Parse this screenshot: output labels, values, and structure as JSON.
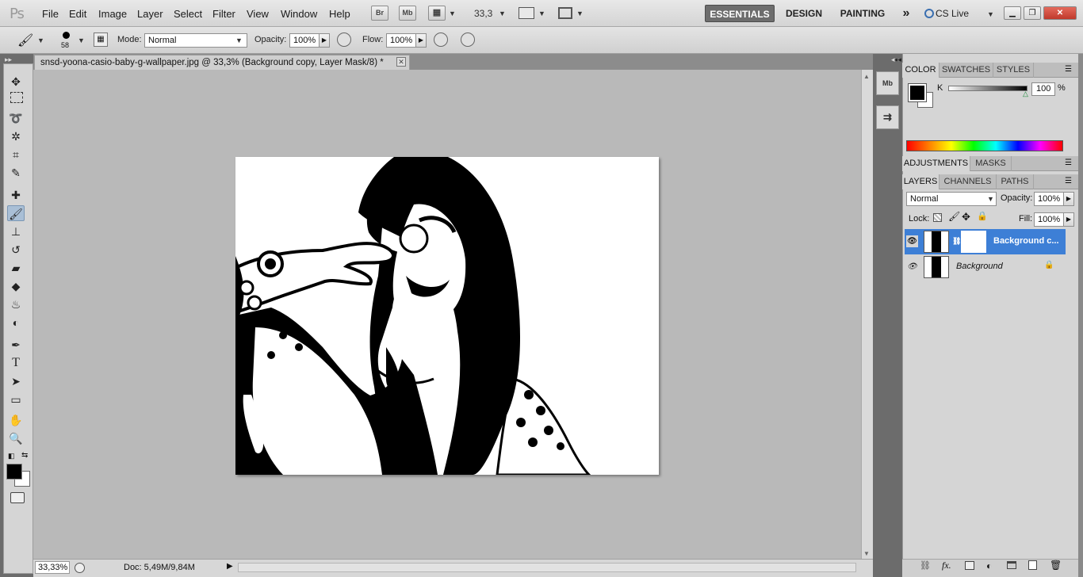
{
  "app": {
    "logo": "Ps"
  },
  "menu": [
    "File",
    "Edit",
    "Image",
    "Layer",
    "Select",
    "Filter",
    "View",
    "Window",
    "Help"
  ],
  "toolbar_buttons": {
    "bridge": "Br",
    "mini_bridge": "Mb"
  },
  "zoom_display": "33,3",
  "workspaces": {
    "essentials": "ESSENTIALS",
    "design": "DESIGN",
    "painting": "PAINTING",
    "more": "»"
  },
  "cs_live": "CS Live",
  "options": {
    "brush_size": "58",
    "mode_label": "Mode:",
    "mode_value": "Normal",
    "opacity_label": "Opacity:",
    "opacity_value": "100%",
    "flow_label": "Flow:",
    "flow_value": "100%"
  },
  "document": {
    "tab_title": "snsd-yoona-casio-baby-g-wallpaper.jpg @ 33,3% (Background copy, Layer Mask/8) *",
    "zoom_percent": "33,33%",
    "doc_size": "Doc: 5,49M/9,84M"
  },
  "color_panel": {
    "tabs": [
      "COLOR",
      "SWATCHES",
      "STYLES"
    ],
    "k_label": "K",
    "k_value": "100",
    "percent": "%"
  },
  "adjustments_panel": {
    "tabs": [
      "ADJUSTMENTS",
      "MASKS"
    ]
  },
  "layers_panel": {
    "tabs": [
      "LAYERS",
      "CHANNELS",
      "PATHS"
    ],
    "blend_mode": "Normal",
    "opacity_label": "Opacity:",
    "opacity_value": "100%",
    "lock_label": "Lock:",
    "fill_label": "Fill:",
    "fill_value": "100%",
    "layers": [
      {
        "name": "Background c...",
        "selected": true
      },
      {
        "name": "Background",
        "selected": false
      }
    ]
  },
  "colors": {
    "accent": "#3d7fd6",
    "foreground": "#000000",
    "background": "#ffffff"
  }
}
